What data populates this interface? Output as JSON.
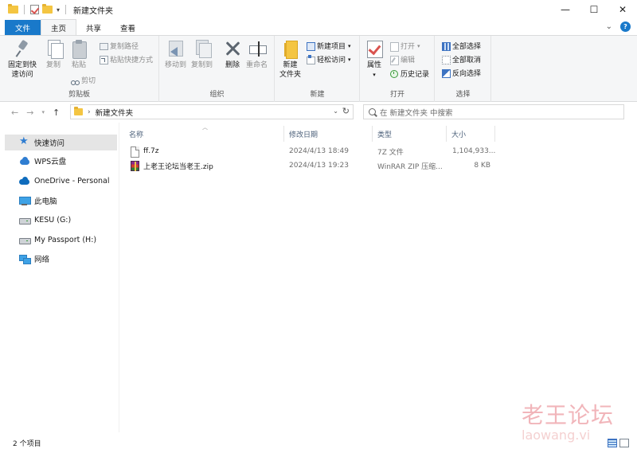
{
  "window": {
    "title": "新建文件夹",
    "controls": {
      "minimize": "—",
      "maximize": "☐",
      "close": "✕"
    }
  },
  "ribbon_tabs": [
    "文件",
    "主页",
    "共享",
    "查看"
  ],
  "ribbon": {
    "clipboard": {
      "label": "剪贴板",
      "pin_line1": "固定到快",
      "pin_line2": "速访问",
      "copy": "复制",
      "paste": "粘贴",
      "copy_path": "复制路径",
      "paste_shortcut": "粘贴快捷方式",
      "cut": "剪切"
    },
    "organize": {
      "label": "组织",
      "move_to": "移动到",
      "copy_to": "复制到",
      "delete": "删除",
      "rename": "重命名"
    },
    "new": {
      "label": "新建",
      "new_folder_line1": "新建",
      "new_folder_line2": "文件夹",
      "new_item": "新建项目",
      "easy_access": "轻松访问"
    },
    "open": {
      "label": "打开",
      "properties": "属性",
      "open": "打开",
      "edit": "编辑",
      "history": "历史记录"
    },
    "select": {
      "label": "选择",
      "select_all": "全部选择",
      "select_none": "全部取消",
      "invert": "反向选择"
    }
  },
  "address": {
    "path": "新建文件夹",
    "search_placeholder": "在 新建文件夹 中搜索"
  },
  "nav_pane": [
    {
      "label": "快速访问",
      "icon": "star-icon"
    },
    {
      "label": "WPS云盘",
      "icon": "cloud-icon"
    },
    {
      "label": "OneDrive - Personal",
      "icon": "onedrive-icon"
    },
    {
      "label": "此电脑",
      "icon": "computer-icon"
    },
    {
      "label": "KESU (G:)",
      "icon": "drive-icon"
    },
    {
      "label": "My Passport (H:)",
      "icon": "drive-icon"
    },
    {
      "label": "网络",
      "icon": "network-icon"
    }
  ],
  "columns": [
    "名称",
    "修改日期",
    "类型",
    "大小"
  ],
  "files": [
    {
      "name": "ff.7z",
      "modified": "2024/4/13 18:49",
      "type": "7Z 文件",
      "size": "1,104,933...",
      "icon": "7z-file-icon"
    },
    {
      "name": "上老王论坛当老王.zip",
      "modified": "2024/4/13 19:23",
      "type": "WinRAR ZIP 压缩...",
      "size": "8 KB",
      "icon": "winrar-zip-icon"
    }
  ],
  "status": {
    "item_count": "2 个项目"
  },
  "watermark": {
    "line1": "老王论坛",
    "line2": "laowang.vi"
  }
}
